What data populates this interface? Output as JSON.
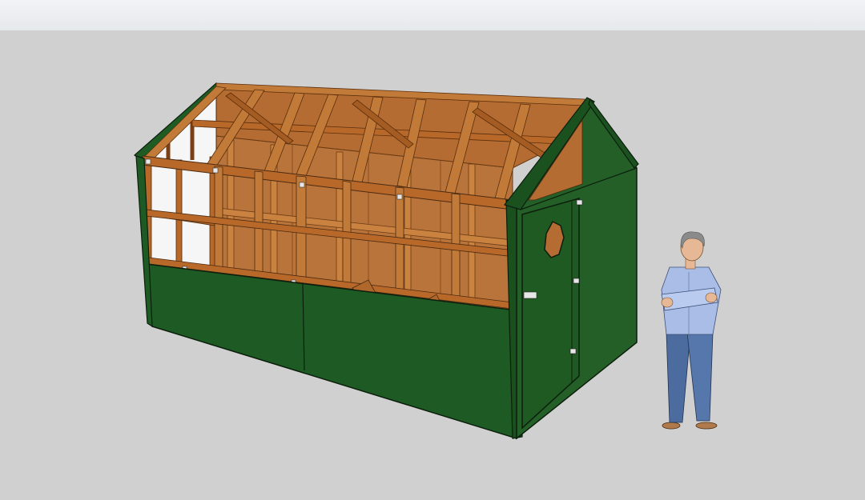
{
  "app": {
    "viewport_background": "#d0d0d0",
    "toolbar_background": "#eceef0"
  },
  "colors": {
    "siding_green_front": "#1e5a23",
    "siding_green_side": "#235f26",
    "siding_outline": "#0c1f0d",
    "plywood": "#b9743b",
    "plywood_dark": "#9a5a28",
    "framing_wood": "#b8692a",
    "framing_wood_shadow": "#7a3f14",
    "glazing": "#f4f4f4",
    "shirt_blue": "#a9bde6",
    "jeans_blue": "#4c6b9e",
    "hair_gray": "#8a8a8a",
    "skin": "#e6b896",
    "shoes": "#b07a4a"
  },
  "scene": {
    "model": "chicken-coop-greenhouse",
    "icons": [
      "scale-figure-icon"
    ]
  }
}
